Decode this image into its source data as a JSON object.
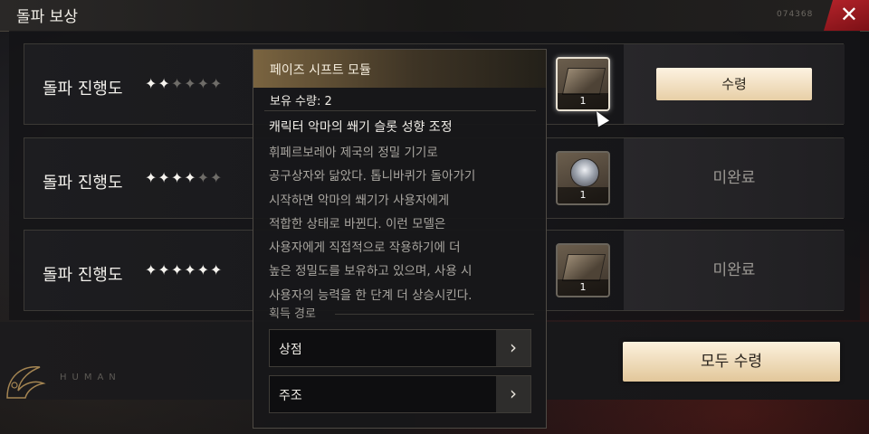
{
  "header": {
    "title": "돌파 보상",
    "code": "074368",
    "close_label": "✕"
  },
  "rows": [
    {
      "label": "돌파 진행도",
      "stars_on": "✦✦",
      "stars_off": "✦✦✦✦",
      "reward_count": "1",
      "reward_icon": "phase-shift-module-icon",
      "status": "수령"
    },
    {
      "label": "돌파 진행도",
      "stars_on": "✦✦✦✦",
      "stars_off": "✦✦",
      "reward_count": "1",
      "reward_icon": "crystal-item-icon",
      "status": "미완료"
    },
    {
      "label": "돌파 진행도",
      "stars_on": "✦✦✦✦✦✦",
      "stars_off": "",
      "reward_count": "1",
      "reward_icon": "phase-shift-module-icon",
      "status": "미완료"
    }
  ],
  "footer": {
    "code": "HUMAN",
    "claim_all_label": "모두 수령"
  },
  "tooltip": {
    "title": "페이즈 시프트 모듈",
    "owned": "보유 수량: 2",
    "effect": "캐릭터 악마의 쐐기 슬롯 성향 조정",
    "description": "휘페르보레아 제국의 정밀 기기로\n공구상자와 닮았다. 톱니바퀴가 돌아가기\n시작하면 악마의 쐐기가 사용자에게\n적합한 상태로 바뀐다. 이런 모델은\n사용자에게 직접적으로 작용하기에 더\n높은 정밀도를 보유하고 있으며, 사용 시\n사용자의 능력을 한 단계 더 상승시킨다.",
    "source_label": "획득 경로",
    "sources": [
      {
        "label": "상점"
      },
      {
        "label": "주조"
      }
    ]
  },
  "colors": {
    "close_red": "#b4232a",
    "button_cream": "#fcf1dd",
    "header_gold": "#7a6440"
  }
}
